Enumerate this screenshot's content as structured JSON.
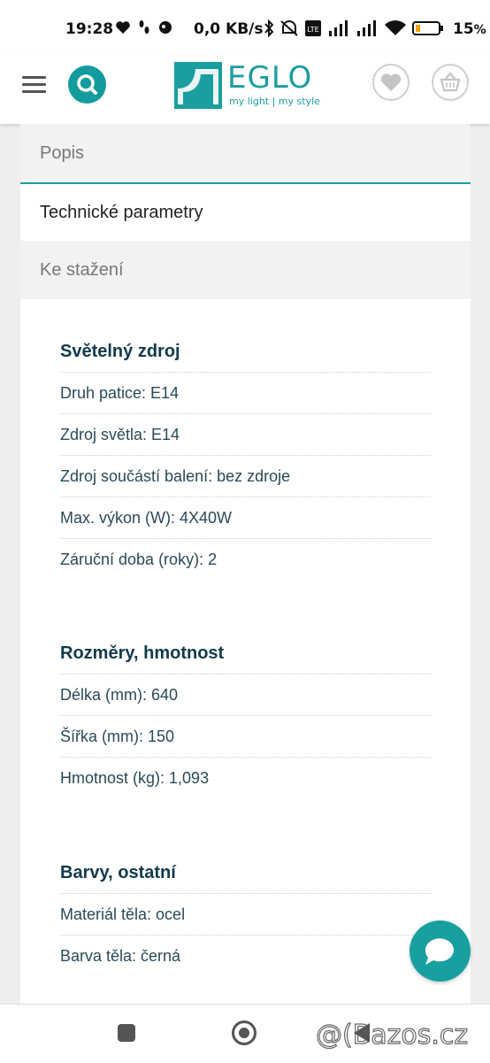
{
  "status_bar": {
    "time": "19:28",
    "network_speed": "0,0 KB/s",
    "battery_percent": "15",
    "battery_suffix": "%"
  },
  "header": {
    "logo_text": "EGLO",
    "logo_tagline": "my light | my style",
    "icons": [
      "menu-icon",
      "search-icon",
      "heart-icon",
      "basket-icon"
    ]
  },
  "tabs": [
    {
      "label": "Popis",
      "active": false
    },
    {
      "label": "Technické parametry",
      "active": true
    },
    {
      "label": "Ke stažení",
      "active": false
    }
  ],
  "sections": [
    {
      "title": "Světelný zdroj",
      "rows": [
        "Druh patice: E14",
        "Zdroj světla: E14",
        "Zdroj součástí balení: bez zdroje",
        "Max. výkon (W): 4X40W",
        "Záruční doba (roky): 2"
      ]
    },
    {
      "title": "Rozměry, hmotnost",
      "rows": [
        "Délka (mm): 640",
        "Šířka (mm): 150",
        "Hmotnost (kg): 1,093"
      ]
    },
    {
      "title": "Barvy, ostatní",
      "rows": [
        "Materiál těla: ocel",
        "Barva těla: černá"
      ]
    }
  ],
  "watermark": "@(Bazos.cz",
  "colors": {
    "accent": "#18a0a0",
    "heading": "#113a4a",
    "body_text": "#2a4a58"
  }
}
